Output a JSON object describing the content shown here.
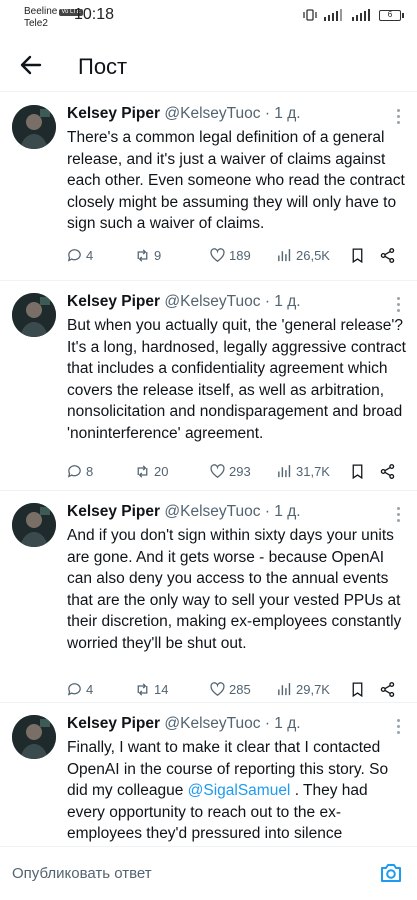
{
  "status_bar": {
    "carrier_1": "Beeline",
    "carrier_1_tag": "Vo LTE",
    "carrier_2": "Tele2",
    "time": "10:18",
    "battery": "6"
  },
  "header": {
    "title": "Пост"
  },
  "tweets": [
    {
      "author": "Kelsey Piper",
      "handle": "@KelseyTuoc",
      "time": "· 1 д.",
      "text": "There's a common legal definition of a general release, and it's just a waiver of claims against each other. Even someone who read the contract closely might be assuming they will only have to sign such a waiver of claims.",
      "replies": "4",
      "reposts": "9",
      "likes": "189",
      "views": "26,5K"
    },
    {
      "author": "Kelsey Piper",
      "handle": "@KelseyTuoc",
      "time": "· 1 д.",
      "text": "But when you actually quit, the 'general release'? It's a long, hardnosed, legally aggressive contract that includes a confidentiality agreement which covers the release itself, as well as arbitration, nonsolicitation  and nondisparagement and broad 'noninterference' agreement.",
      "replies": "8",
      "reposts": "20",
      "likes": "293",
      "views": "31,7K"
    },
    {
      "author": "Kelsey Piper",
      "handle": "@KelseyTuoc",
      "time": "· 1 д.",
      "text": "And if you don't sign within sixty days your units are gone. And it gets worse - because OpenAI can also deny you access to the annual events that are the only way to sell your vested PPUs at their discretion, making ex-employees constantly worried they'll be shut out.",
      "replies": "4",
      "reposts": "14",
      "likes": "285",
      "views": "29,7K"
    },
    {
      "author": "Kelsey Piper",
      "handle": "@KelseyTuoc",
      "time": "· 1 д.",
      "text_before": "Finally, I want to make it clear that I contacted OpenAI in the course of reporting this story. So did my colleague ",
      "mention": "@SigalSamuel",
      "text_after": " . They had every opportunity to reach out to the ex-employees they'd pressured into silence"
    }
  ],
  "reply": {
    "placeholder": "Опубликовать ответ"
  },
  "colors": {
    "text": "#0f1419",
    "secondary": "#536471",
    "accent": "#1d9bf0",
    "divider": "#eff3f4"
  },
  "icons": [
    "arrow-left-icon",
    "reply-icon",
    "repost-icon",
    "like-icon",
    "views-icon",
    "bookmark-icon",
    "share-icon",
    "camera-icon",
    "more-icon"
  ]
}
